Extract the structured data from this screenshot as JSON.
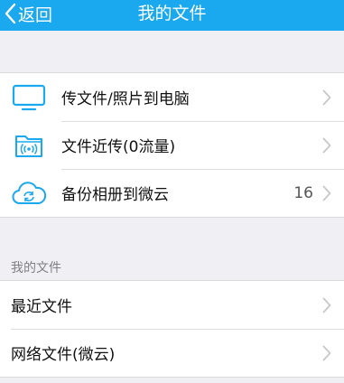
{
  "nav": {
    "back_label": "返回",
    "title": "我的文件",
    "background_color": "#1aa8ee"
  },
  "transfer_items": [
    {
      "label": "传文件/照片到电脑",
      "icon": "monitor-icon"
    },
    {
      "label": "文件近传(0流量)",
      "icon": "folder-wireless-icon"
    },
    {
      "label": "备份相册到微云",
      "icon": "cloud-sync-icon",
      "count": "16"
    }
  ],
  "my_files": {
    "header": "我的文件",
    "items": [
      {
        "label": "最近文件"
      },
      {
        "label": "网络文件(微云)"
      }
    ]
  },
  "icon_color": "#1aa8ee"
}
